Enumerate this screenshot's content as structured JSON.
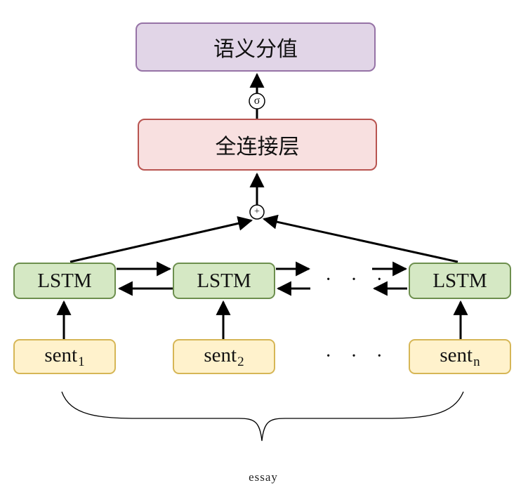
{
  "nodes": {
    "semantic_score": "语义分值",
    "fully_connected": "全连接层",
    "lstm_labels": [
      "LSTM",
      "LSTM",
      "LSTM"
    ],
    "sentences": [
      {
        "base": "sent",
        "sub": "1"
      },
      {
        "base": "sent",
        "sub": "2"
      },
      {
        "base": "sent",
        "sub": "n"
      }
    ]
  },
  "operators": {
    "sigma": "σ",
    "plus": "+"
  },
  "ellipsis": "· · ·",
  "brace_label": "essay",
  "colors": {
    "score_fill": "#e1d5e7",
    "score_border": "#9673a6",
    "fc_fill": "#f8e0e0",
    "fc_border": "#b85450",
    "lstm_fill": "#d5e8c4",
    "lstm_border": "#6d8f4e",
    "sent_fill": "#fff2cc",
    "sent_border": "#d6b656"
  }
}
